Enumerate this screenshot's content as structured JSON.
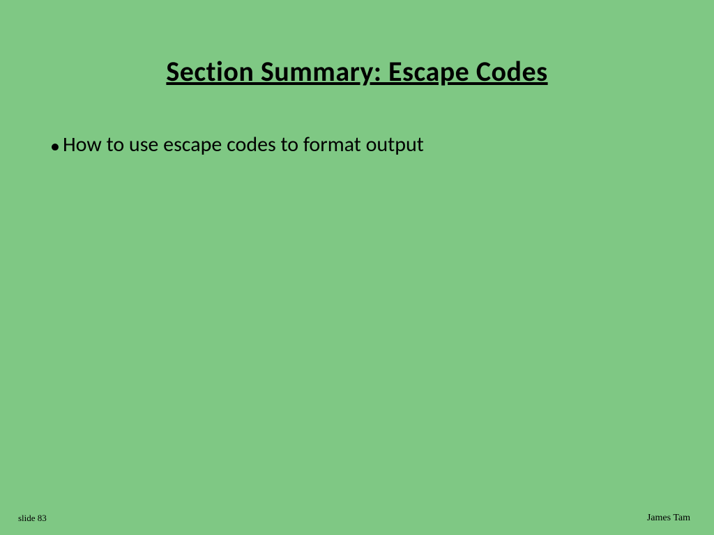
{
  "slide": {
    "title": "Section Summary: Escape Codes",
    "bullets": [
      {
        "text": "How to use escape codes to format output"
      }
    ]
  },
  "footer": {
    "left": "slide 83",
    "right": "James Tam"
  }
}
